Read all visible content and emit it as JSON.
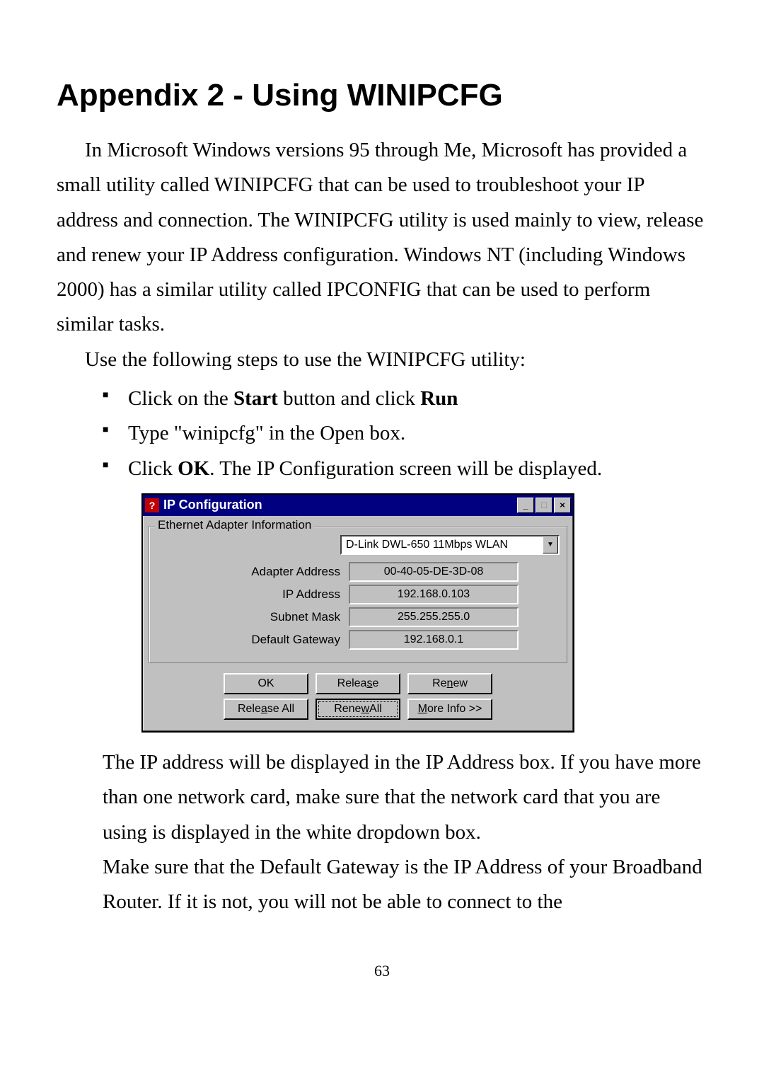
{
  "heading": "Appendix 2 - Using WINIPCFG",
  "para1": "In Microsoft Windows versions 95 through Me, Microsoft has provided a small utility called WINIPCFG that can be used to troubleshoot your IP address and connection. The WINIPCFG utility is used mainly to view, release and renew your IP Address configuration. Windows NT (including Windows 2000) has a similar utility called IPCONFIG that can be used to perform similar tasks.",
  "para2": "Use the following steps to use the WINIPCFG utility:",
  "bullets": {
    "b1_pre": "Click on the ",
    "b1_start": "Start",
    "b1_mid": " button and click ",
    "b1_run": "Run",
    "b2": "Type \"winipcfg\" in the Open box.",
    "b3_pre": "Click ",
    "b3_ok": "OK",
    "b3_post": ". The IP Configuration screen will be displayed."
  },
  "dialog": {
    "title": "IP Configuration",
    "group_label": "Ethernet Adapter Information",
    "adapter_selected": "D-Link DWL-650 11Mbps WLAN",
    "labels": {
      "adapter_address": "Adapter Address",
      "ip_address": "IP Address",
      "subnet_mask": "Subnet Mask",
      "default_gateway": "Default Gateway"
    },
    "values": {
      "adapter_address": "00-40-05-DE-3D-08",
      "ip_address": "192.168.0.103",
      "subnet_mask": "255.255.255.0",
      "default_gateway": "192.168.0.1"
    },
    "buttons": {
      "ok": "OK",
      "release": "Release",
      "renew": "Renew",
      "release_all": "Release All",
      "renew_all": "Renew All",
      "more_info": "More Info >>"
    },
    "mnemonics": {
      "release": "s",
      "renew": "n",
      "release_all": "a",
      "renew_all": "w",
      "more_info": "M"
    }
  },
  "para3": "The IP address will be displayed in the IP Address box. If you have more than one network card, make sure that the network card that you are using is displayed in the white dropdown box.",
  "para4": "Make sure that the Default Gateway is the IP Address of your Broadband Router. If it is not, you will not be able to connect to the",
  "page_number": "63"
}
